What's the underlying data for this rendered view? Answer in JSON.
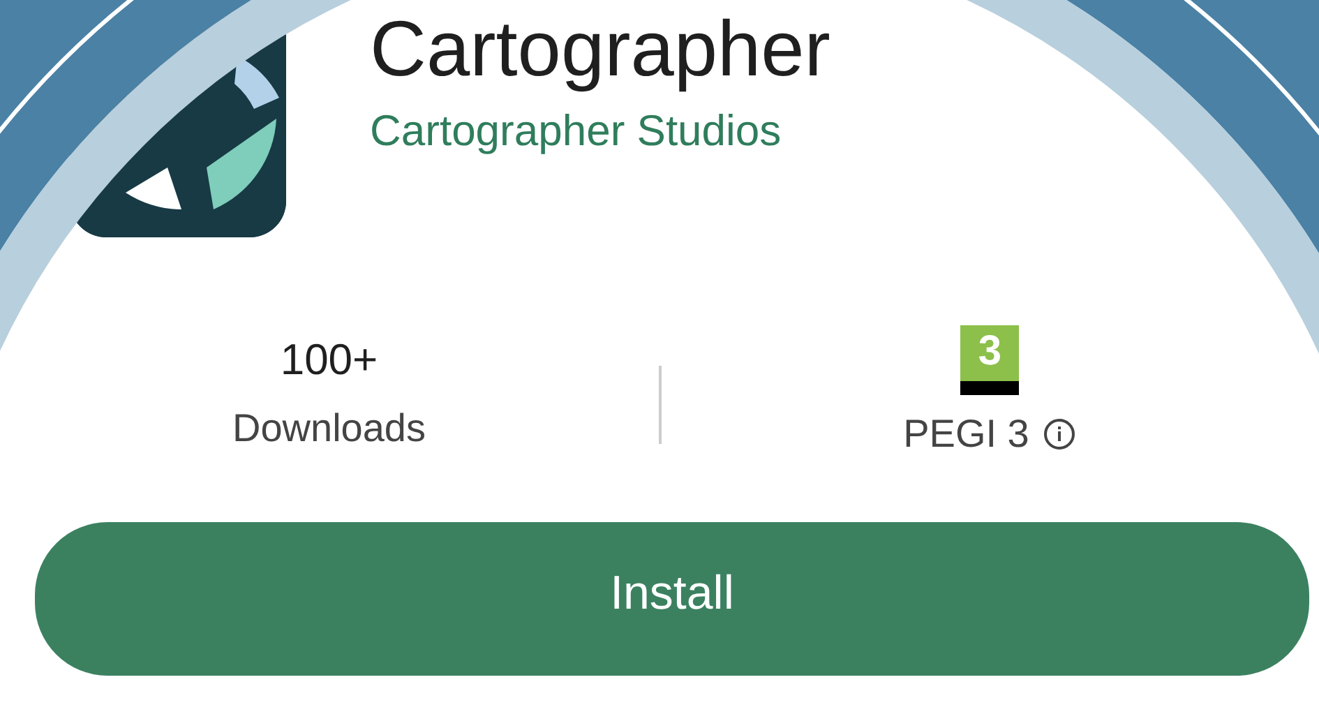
{
  "app": {
    "title": "Cartographer",
    "developer": "Cartographer Studios"
  },
  "stats": [
    {
      "kind": "count",
      "value": "100+",
      "label": "Downloads"
    },
    {
      "kind": "rating",
      "badge": "3",
      "label": "PEGI 3"
    }
  ],
  "install_button": "Install"
}
